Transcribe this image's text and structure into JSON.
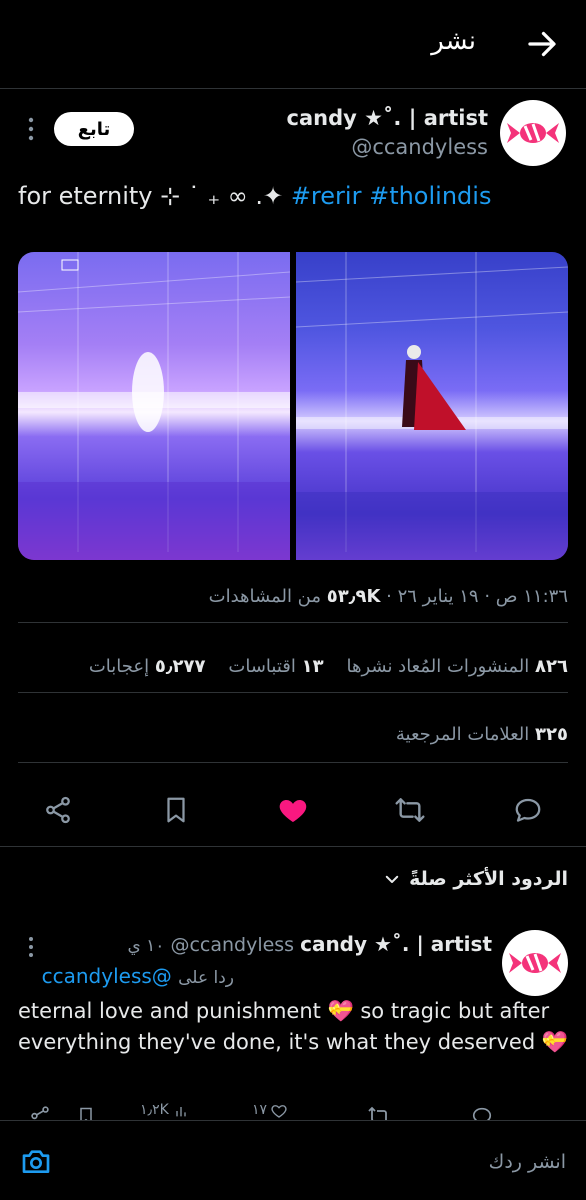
{
  "header": {
    "title": "نشر"
  },
  "post": {
    "display_name": "candy ★˚. | artist",
    "handle": "@ccandyless",
    "follow_label": "تابع",
    "text_plain": "for eternity ⊹ ˙ ₊ ∞ .✦",
    "hashtags": [
      "#rerir",
      "#tholindis"
    ],
    "timestamp": "١١:٣٦ ص · ١٩ يناير ٢٦ ·",
    "views_value": "٥٣٫٩K",
    "views_label": "من المشاهدات",
    "stats": {
      "reposts_value": "٨٢٦",
      "reposts_label": "المنشورات المُعاد نشرها",
      "quotes_value": "١٣",
      "quotes_label": "اقتباسات",
      "likes_value": "٥٫٢٧٧",
      "likes_label": "إعجابات",
      "bookmarks_value": "٣٢٥",
      "bookmarks_label": "العلامات المرجعية"
    },
    "liked": true
  },
  "replies_sort": {
    "label": "الردود الأكثر صلةً"
  },
  "reply": {
    "display_name": "candy ★˚. | artist",
    "handle": "@ccandyless",
    "time": "١٠ ي",
    "replying_prefix": "ردا على",
    "replying_to": "@ccandyless",
    "text": "eternal love and punishment 💝 so tragic but after everything they've done, it's what they deserved 💝",
    "likes": "١٧",
    "views": "١٫٢K"
  },
  "composer": {
    "placeholder": "انشر ردك"
  },
  "colors": {
    "accent": "#1d9bf0",
    "like": "#f91880",
    "background": "#000000"
  }
}
